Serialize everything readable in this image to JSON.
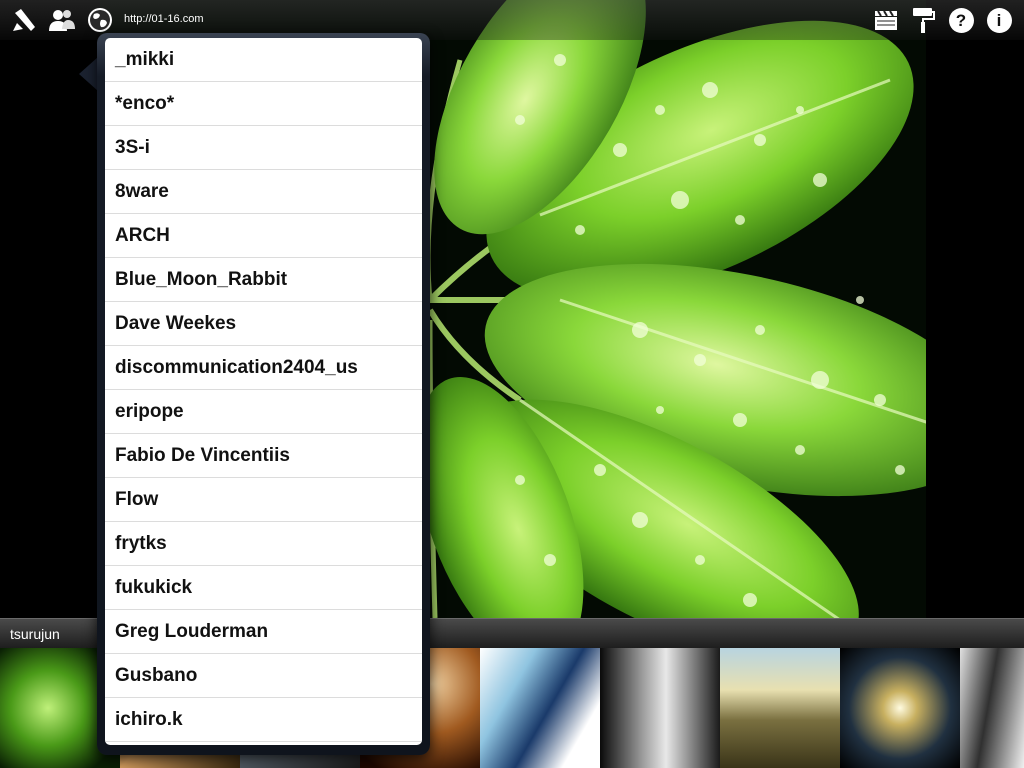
{
  "toolbar": {
    "url": "http://01-16.com",
    "left_icons": [
      "pencil-icon",
      "users-icon",
      "globe-icon"
    ],
    "right_icons": [
      "clapperboard-icon",
      "paint-roller-icon",
      "help-icon",
      "info-icon"
    ],
    "help_glyph": "?",
    "info_glyph": "i"
  },
  "popover": {
    "items": [
      "_mikki",
      "*enco*",
      "3S-i",
      "8ware",
      "ARCH",
      "Blue_Moon_Rabbit",
      "Dave Weekes",
      "discommunication2404_us",
      "eripope",
      "Fabio De Vincentiis",
      "Flow",
      "frytks",
      "fukukick",
      "Greg Louderman",
      "Gusbano",
      "ichiro.k"
    ]
  },
  "user_bar": {
    "username": "tsurujun"
  },
  "colors": {
    "leaf_green": "#7cd02a",
    "leaf_dark": "#2c6a10",
    "popover_frame": "#151b26"
  }
}
